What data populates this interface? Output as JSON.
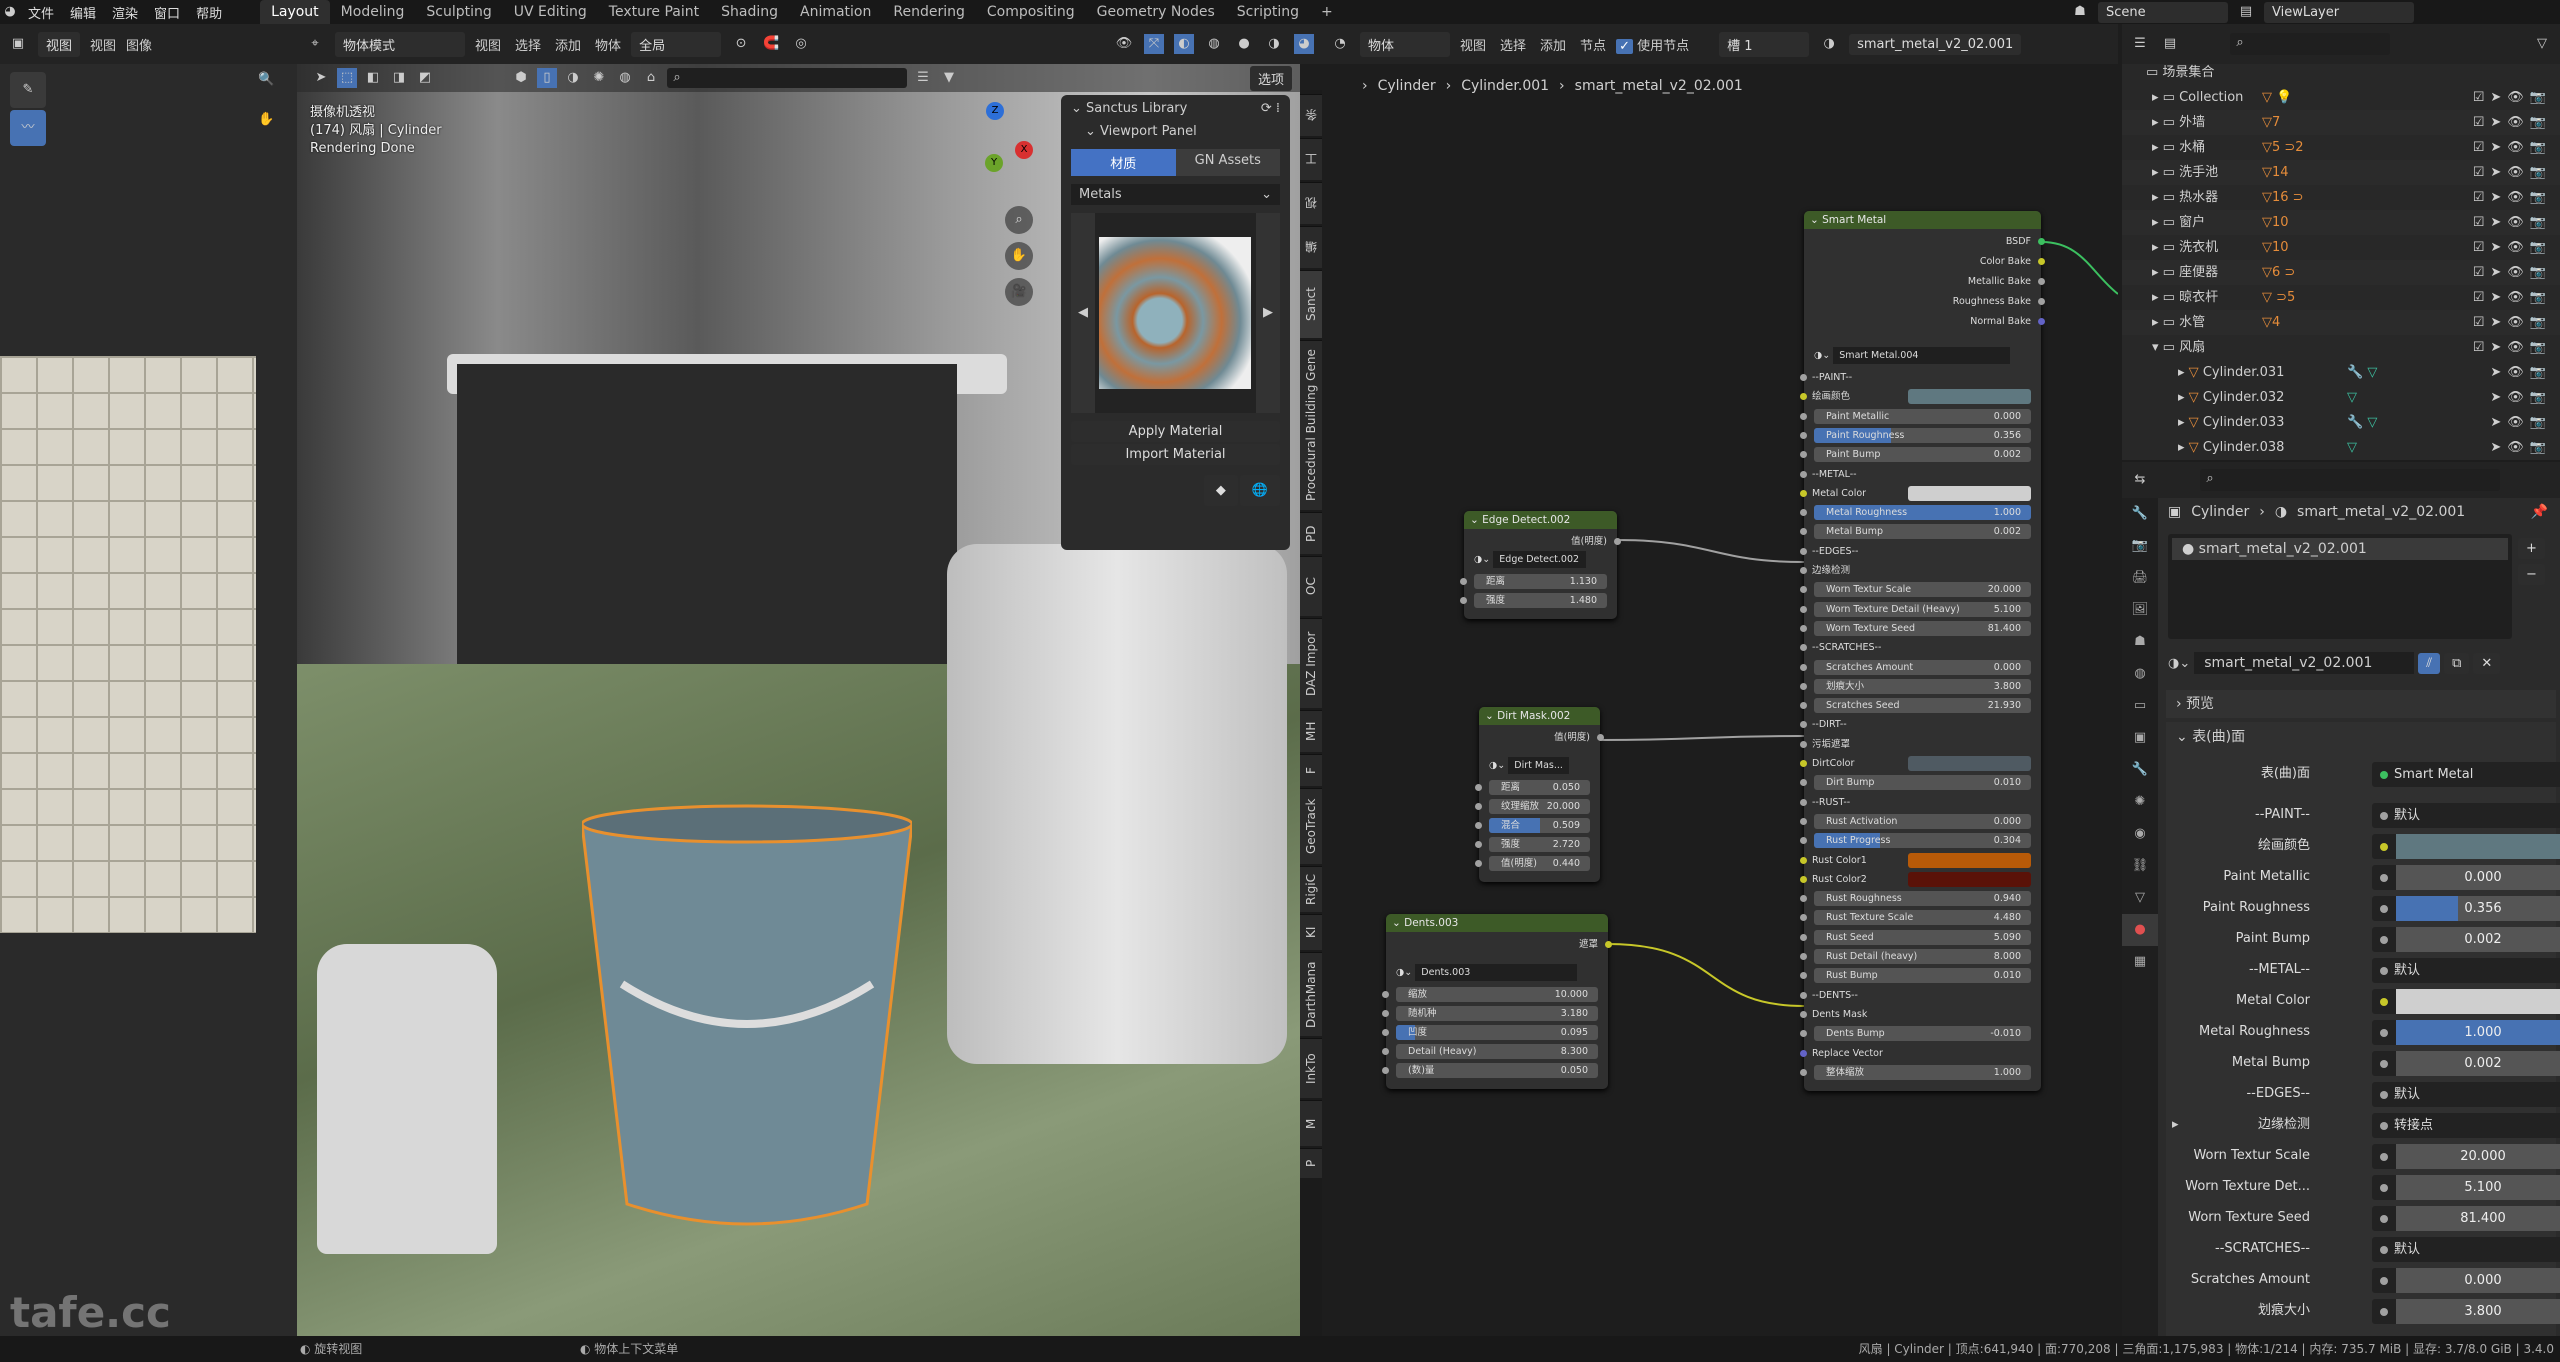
{
  "topbar": {
    "menus": [
      "文件",
      "编辑",
      "渲染",
      "窗口",
      "帮助"
    ],
    "workspaces": [
      "Layout",
      "Modeling",
      "Sculpting",
      "UV Editing",
      "Texture Paint",
      "Shading",
      "Animation",
      "Rendering",
      "Compositing",
      "Geometry Nodes",
      "Scripting"
    ],
    "active_workspace": "Layout",
    "add_workspace": "+",
    "scene": "Scene",
    "view_layer": "ViewLayer"
  },
  "image_editor": {
    "header": [
      "视图",
      "视图",
      "图像"
    ]
  },
  "viewport": {
    "mode": "物体模式",
    "menus": [
      "视图",
      "选择",
      "添加",
      "物体"
    ],
    "transform": "全局",
    "options": "选项",
    "overlay_lines": [
      "摄像机透视",
      "(174) 风扇 | Cylinder",
      "Rendering Done"
    ],
    "gizmo": {
      "x": "X",
      "y": "Y",
      "z": "Z"
    }
  },
  "sanctus": {
    "title": "Sanctus Library",
    "subpanel": "Viewport Panel",
    "tabs": [
      "材质",
      "GN Assets"
    ],
    "category": "Metals",
    "apply": "Apply Material",
    "import": "Import Material"
  },
  "side_tabs": [
    "条",
    "工",
    "视",
    "编",
    "Sanct",
    "Procedural Building Gene",
    "PD",
    "OC",
    "DAZ Impor",
    "MH",
    "F",
    "GeoTrack",
    "RigiC",
    "KI",
    "DarthMana",
    "InkTo",
    "M",
    "P"
  ],
  "node_editor": {
    "object": "物体",
    "menus": [
      "视图",
      "选择",
      "添加",
      "节点"
    ],
    "use_nodes": "使用节点",
    "slot": "槽 1",
    "material": "smart_metal_v2_02.001",
    "breadcrumb": [
      "Cylinder",
      "Cylinder.001",
      "smart_metal_v2_02.001"
    ],
    "nodes": {
      "smart": {
        "title": "Smart Metal",
        "outputs": [
          "BSDF",
          "Color Bake",
          "Metallic Bake",
          "Roughness Bake",
          "Normal Bake"
        ],
        "group": "Smart Metal.004",
        "inputs": [
          {
            "t": "sep",
            "label": "--PAINT--"
          },
          {
            "t": "color",
            "label": "绘画颜色",
            "color": "#5f7880"
          },
          {
            "t": "val",
            "label": "Paint Metallic",
            "value": "0.000"
          },
          {
            "t": "val",
            "label": "Paint Roughness",
            "value": "0.356",
            "factor": 0.356
          },
          {
            "t": "val",
            "label": "Paint Bump",
            "value": "0.002"
          },
          {
            "t": "sep",
            "label": "--METAL--"
          },
          {
            "t": "color",
            "label": "Metal Color",
            "color": "#cfcfcf"
          },
          {
            "t": "val",
            "label": "Metal Roughness",
            "value": "1.000",
            "factor": 1.0
          },
          {
            "t": "val",
            "label": "Metal Bump",
            "value": "0.002"
          },
          {
            "t": "sep",
            "label": "--EDGES--"
          },
          {
            "t": "sep",
            "label": "边缘检测"
          },
          {
            "t": "val",
            "label": "Worn Textur Scale",
            "value": "20.000"
          },
          {
            "t": "val",
            "label": "Worn Texture Detail (Heavy)",
            "value": "5.100"
          },
          {
            "t": "val",
            "label": "Worn Texture Seed",
            "value": "81.400"
          },
          {
            "t": "sep",
            "label": "--SCRATCHES--"
          },
          {
            "t": "val",
            "label": "Scratches Amount",
            "value": "0.000"
          },
          {
            "t": "val",
            "label": "划痕大小",
            "value": "3.800"
          },
          {
            "t": "val",
            "label": "Scratches Seed",
            "value": "21.930"
          },
          {
            "t": "sep",
            "label": "--DIRT--"
          },
          {
            "t": "sep",
            "label": "污垢遮罩"
          },
          {
            "t": "color",
            "label": "DirtColor",
            "color": "#4f5a62"
          },
          {
            "t": "val",
            "label": "Dirt Bump",
            "value": "0.010"
          },
          {
            "t": "sep",
            "label": "--RUST--"
          },
          {
            "t": "val",
            "label": "Rust Activation",
            "value": "0.000"
          },
          {
            "t": "val",
            "label": "Rust Progress",
            "value": "0.304",
            "factor": 0.304
          },
          {
            "t": "color",
            "label": "Rust Color1",
            "color": "#b85a08"
          },
          {
            "t": "color",
            "label": "Rust Color2",
            "color": "#5a1208"
          },
          {
            "t": "val",
            "label": "Rust Roughness",
            "value": "0.940"
          },
          {
            "t": "val",
            "label": "Rust Texture Scale",
            "value": "4.480"
          },
          {
            "t": "val",
            "label": "Rust Seed",
            "value": "5.090"
          },
          {
            "t": "val",
            "label": "Rust Detail (heavy)",
            "value": "8.000"
          },
          {
            "t": "val",
            "label": "Rust Bump",
            "value": "0.010"
          },
          {
            "t": "sep",
            "label": "--DENTS--"
          },
          {
            "t": "sep",
            "label": "Dents  Mask"
          },
          {
            "t": "val",
            "label": "Dents Bump",
            "value": "-0.010"
          },
          {
            "t": "sep",
            "label": "Replace Vector",
            "vector": true
          },
          {
            "t": "val",
            "label": "整体缩放",
            "value": "1.000"
          }
        ]
      },
      "edge": {
        "title": "Edge Detect.002",
        "output": "值(明度)",
        "group": "Edge Detect.002",
        "inputs": [
          {
            "t": "val",
            "label": "距离",
            "value": "1.130"
          },
          {
            "t": "val",
            "label": "强度",
            "value": "1.480"
          }
        ]
      },
      "dirt": {
        "title": "Dirt Mask.002",
        "output": "值(明度)",
        "group": "Dirt Mas...",
        "inputs": [
          {
            "t": "val",
            "label": "距离",
            "value": "0.050"
          },
          {
            "t": "val",
            "label": "纹理缩放",
            "value": "20.000"
          },
          {
            "t": "val",
            "label": "混合",
            "value": "0.509",
            "factor": 0.509
          },
          {
            "t": "val",
            "label": "强度",
            "value": "2.720"
          },
          {
            "t": "val",
            "label": "值(明度)",
            "value": "0.440"
          }
        ]
      },
      "dents": {
        "title": "Dents.003",
        "output": "遮罩",
        "group": "Dents.003",
        "inputs": [
          {
            "t": "val",
            "label": "缩放",
            "value": "10.000"
          },
          {
            "t": "val",
            "label": "随机种",
            "value": "3.180"
          },
          {
            "t": "val",
            "label": "凹度",
            "value": "0.095",
            "factor": 0.095
          },
          {
            "t": "val",
            "label": "Detail (Heavy)",
            "value": "8.300"
          },
          {
            "t": "val",
            "label": "(数)量",
            "value": "0.050"
          }
        ]
      }
    }
  },
  "outliner": {
    "root": "场景集合",
    "items": [
      {
        "name": "Collection",
        "badges": "▽ 💡"
      },
      {
        "name": "外墙",
        "badges": "▽7"
      },
      {
        "name": "水桶",
        "badges": "▽5 ⊃2"
      },
      {
        "name": "洗手池",
        "badges": "▽14"
      },
      {
        "name": "热水器",
        "badges": "▽16 ⊃"
      },
      {
        "name": "窗户",
        "badges": "▽10"
      },
      {
        "name": "洗衣机",
        "badges": "▽10"
      },
      {
        "name": "座便器",
        "badges": "▽6 ⊃"
      },
      {
        "name": "晾衣杆",
        "badges": "▽ ⊃5"
      },
      {
        "name": "水管",
        "badges": "▽4"
      },
      {
        "name": "风扇",
        "badges": "",
        "expanded": true
      }
    ],
    "children": [
      {
        "name": "Cylinder.031",
        "mods": "🔧 ▽"
      },
      {
        "name": "Cylinder.032",
        "mods": "▽"
      },
      {
        "name": "Cylinder.033",
        "mods": "🔧 ▽"
      },
      {
        "name": "Cylinder.038",
        "mods": "▽"
      }
    ]
  },
  "properties": {
    "breadcrumb": [
      "Cylinder",
      "smart_metal_v2_02.001"
    ],
    "slot": "smart_metal_v2_02.001",
    "material": "smart_metal_v2_02.001",
    "preview_panel": "预览",
    "surface_panel": "表(曲)面",
    "surface_label": "表(曲)面",
    "surface_value": "Smart Metal",
    "rows": [
      {
        "t": "enum",
        "label": "--PAINT--",
        "value": "默认"
      },
      {
        "t": "color",
        "label": "绘画颜色",
        "color": "#5f7880"
      },
      {
        "t": "val",
        "label": "Paint Metallic",
        "value": "0.000"
      },
      {
        "t": "val",
        "label": "Paint Roughness",
        "value": "0.356",
        "factor": 0.356
      },
      {
        "t": "val",
        "label": "Paint Bump",
        "value": "0.002"
      },
      {
        "t": "enum",
        "label": "--METAL--",
        "value": "默认"
      },
      {
        "t": "color",
        "label": "Metal Color",
        "color": "#cfcfcf"
      },
      {
        "t": "val",
        "label": "Metal Roughness",
        "value": "1.000",
        "factor": 1.0
      },
      {
        "t": "val",
        "label": "Metal Bump",
        "value": "0.002"
      },
      {
        "t": "enum",
        "label": "--EDGES--",
        "value": "默认"
      },
      {
        "t": "enum",
        "label": "边缘检测",
        "value": "转接点",
        "expander": true
      },
      {
        "t": "val",
        "label": "Worn Textur Scale",
        "value": "20.000"
      },
      {
        "t": "val",
        "label": "Worn Texture Det...",
        "value": "5.100"
      },
      {
        "t": "val",
        "label": "Worn Texture Seed",
        "value": "81.400"
      },
      {
        "t": "enum",
        "label": "--SCRATCHES--",
        "value": "默认"
      },
      {
        "t": "val",
        "label": "Scratches Amount",
        "value": "0.000"
      },
      {
        "t": "val",
        "label": "划痕大小",
        "value": "3.800"
      }
    ]
  },
  "status": {
    "watermark": "tafe.cc",
    "hints": [
      "旋转视图",
      "物体上下文菜单"
    ],
    "stats": "风扇 | Cylinder | 顶点:641,940 | 面:770,208 | 三角面:1,175,983 | 物体:1/214 | 内存: 735.7 MiB | 显存: 3.7/8.0 GiB | 3.4.0"
  },
  "colors": {
    "accent": "#4772b3",
    "node_header": "#3d5a27",
    "selection_outline": "#e8902e",
    "socket_color": "#c7c729",
    "socket_shader": "#3cc060",
    "socket_vector": "#6363c7"
  }
}
